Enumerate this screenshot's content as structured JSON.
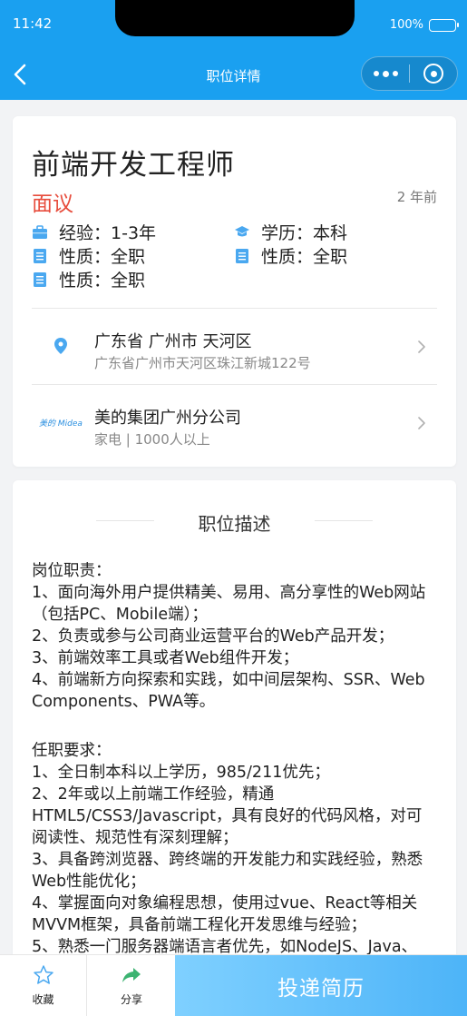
{
  "status_bar": {
    "time": "11:42",
    "battery": "100%"
  },
  "nav": {
    "title": "职位详情"
  },
  "job": {
    "title": "前端开发工程师",
    "salary": "面议",
    "posted": "2 年前",
    "attributes": [
      {
        "label": "经验：1-3年",
        "icon": "briefcase-icon"
      },
      {
        "label": "学历：本科",
        "icon": "graduation-cap-icon"
      },
      {
        "label": "性质：全职",
        "icon": "document-icon"
      },
      {
        "label": "性质：全职",
        "icon": "document-icon"
      },
      {
        "label": "性质：全职",
        "icon": "document-icon"
      }
    ]
  },
  "location": {
    "main": "广东省 广州市 天河区",
    "sub": "广东省广州市天河区珠江新城122号",
    "icon": "location-pin-icon"
  },
  "company": {
    "name": "美的集团广州分公司",
    "sub": "家电 | 1000人以上",
    "logo_text": "美的 Midea"
  },
  "description": {
    "title": "职位描述",
    "section1": [
      "岗位职责：",
      "1、面向海外用户提供精美、易用、高分享性的Web网站（包括PC、Mobile端）；",
      "2、负责或参与公司商业运营平台的Web产品开发；",
      "3、前端效率工具或者Web组件开发；",
      "4、前端新方向探索和实践，如中间层架构、SSR、Web Components、PWA等。"
    ],
    "section2": [
      "任职要求：",
      "1、全日制本科以上学历，985/211优先；",
      "2、2年或以上前端工作经验，精通HTML5/CSS3/Javascript，具有良好的代码风格，对可阅读性、规范性有深刻理解；",
      "3、具备跨浏览器、跨终端的开发能力和实践经验，熟悉Web性能优化；",
      "4、掌握面向对象编程思想，使用过vue、React等相关MVVM框架，具备前端工程化开发思维与经验；",
      "5、熟悉一门服务器端语言者优先，如NodeJS、Java、"
    ]
  },
  "bottom_bar": {
    "favorite_label": "收藏",
    "share_label": "分享",
    "apply_label": "投递简历"
  },
  "colors": {
    "header": "#1aa0f0",
    "salary": "#e74c3c",
    "icon": "#4aa8f0",
    "apply_button": "#5bbcf9"
  }
}
